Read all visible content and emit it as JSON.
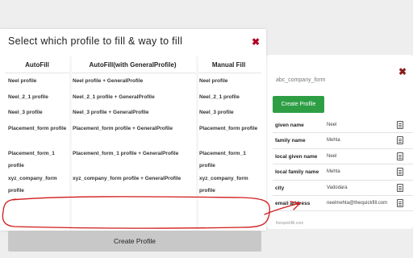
{
  "background_panel": {
    "title": "abc_company_form",
    "create_label": "Create Profile",
    "rows": [
      {
        "label": "given name",
        "value": "Neel"
      },
      {
        "label": "family name",
        "value": "Mehta"
      },
      {
        "label": "local given name",
        "value": "Neel"
      },
      {
        "label": "local family name",
        "value": "Mehta"
      },
      {
        "label": "city",
        "value": "Vadodara"
      },
      {
        "label": "email address",
        "value": "neelmehta@thequickfill.com"
      }
    ],
    "footer": "thequickfill.com"
  },
  "modal": {
    "title": "Select which profile to fill & way to fill",
    "close_label": "✖",
    "columns": [
      "AutoFill",
      "AutoFill(with GeneralProfile)",
      "Manual Fill"
    ],
    "rows": [
      {
        "autofill": "Neel profile",
        "general": "Neel profile + GeneralProfile",
        "manual": "Neel profile"
      },
      {
        "autofill": "Neel_2_1 profile",
        "general": "Neel_2_1 profile + GeneralProfile",
        "manual": "Neel_2_1 profile"
      },
      {
        "autofill": "Neel_3 profile",
        "general": "Neel_3 profile + GeneralProfile",
        "manual": "Neel_3 profile"
      },
      {
        "autofill": "Placement_form profile",
        "general": "Placement_form profile + GeneralProfile",
        "manual": "Placement_form profile"
      },
      {
        "autofill": "Placement_form_1 profile",
        "general": "Placement_form_1 profile + GeneralProfile",
        "manual": "Placement_form_1 profile"
      },
      {
        "autofill": "xyz_company_form profile",
        "general": "xyz_company_form profile + GeneralProfile",
        "manual": "xyz_company_form profile"
      }
    ],
    "create_label": "Create Profile"
  },
  "colors": {
    "close_red": "#b00020",
    "create_green": "#2e9e45",
    "annotation_red": "#d11a1a"
  }
}
